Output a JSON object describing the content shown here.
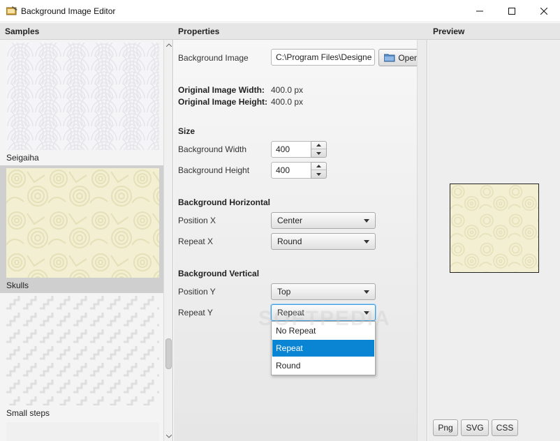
{
  "window": {
    "title": "Background Image Editor",
    "icon": "editor-app-icon",
    "controls": [
      "minimize-icon",
      "maximize-icon",
      "close-icon"
    ]
  },
  "headers": {
    "samples": "Samples",
    "properties": "Properties",
    "preview": "Preview"
  },
  "samples": {
    "items": [
      {
        "label": "Seigaiha",
        "selected": false
      },
      {
        "label": "Skulls",
        "selected": true
      },
      {
        "label": "Small steps",
        "selected": false
      }
    ]
  },
  "properties": {
    "background_image": {
      "label": "Background Image",
      "value": "C:\\Program Files\\Designe",
      "open_label": "Open"
    },
    "original_width": {
      "label": "Original Image Width:",
      "value": "400.0 px"
    },
    "original_height": {
      "label": "Original Image Height:",
      "value": "400.0 px"
    },
    "size": {
      "title": "Size",
      "width": {
        "label": "Background Width",
        "value": "400"
      },
      "height": {
        "label": "Background Height",
        "value": "400"
      }
    },
    "horizontal": {
      "title": "Background Horizontal",
      "position": {
        "label": "Position X",
        "value": "Center"
      },
      "repeat": {
        "label": "Repeat X",
        "value": "Round"
      }
    },
    "vertical": {
      "title": "Background Vertical",
      "position": {
        "label": "Position Y",
        "value": "Top"
      },
      "repeat": {
        "label": "Repeat Y",
        "value": "Repeat"
      }
    },
    "repeat_y_options": [
      "No Repeat",
      "Repeat",
      "Round"
    ],
    "repeat_y_selected": "Repeat"
  },
  "preview": {
    "export_buttons": [
      "Png",
      "SVG",
      "CSS"
    ]
  },
  "colors": {
    "accent": "#0a85d4",
    "panel_header": "#e6e6e6",
    "skulls_pattern": "#f2efd2"
  },
  "watermark": "SOFTPEDIA"
}
